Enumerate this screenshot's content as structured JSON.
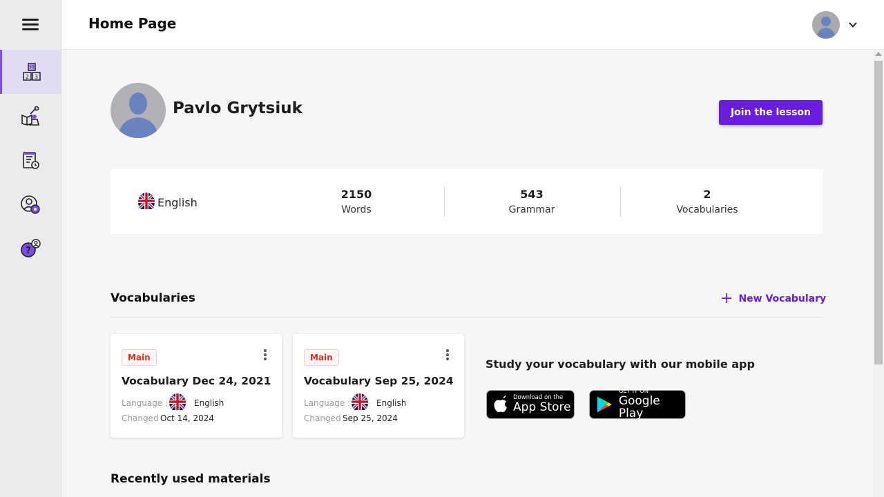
{
  "header": {
    "title": "Home Page"
  },
  "profile": {
    "name": "Pavlo Grytsiuk",
    "join_label": "Join the lesson"
  },
  "stats": {
    "language": "English",
    "items": [
      {
        "value": "2150",
        "label": "Words"
      },
      {
        "value": "543",
        "label": "Grammar"
      },
      {
        "value": "2",
        "label": "Vocabularies"
      }
    ]
  },
  "vocab_section": {
    "title": "Vocabularies",
    "new_label": "New Vocabulary",
    "cards": [
      {
        "badge": "Main",
        "title": "Vocabulary Dec 24, 2021",
        "language_label": "Language :",
        "language": "English",
        "changed_label": "Changed :",
        "changed": "Oct 14, 2024"
      },
      {
        "badge": "Main",
        "title": "Vocabulary Sep 25, 2024",
        "language_label": "Language :",
        "language": "English",
        "changed_label": "Changed :",
        "changed": "Sep 25, 2024"
      }
    ],
    "mobile_title": "Study your vocabulary with our mobile app",
    "app_store": {
      "small": "Download on the",
      "big": "App Store"
    },
    "google_play": {
      "small": "GET IT ON",
      "big": "Google Play"
    }
  },
  "recent": {
    "title": "Recently used materials"
  },
  "colors": {
    "accent": "#6a1de0",
    "badge_red": "#d93025",
    "active_nav": "#e2dcf3"
  },
  "icons": {
    "nav": [
      "blocks-icon",
      "learning-icon",
      "test-icon",
      "user-settings-icon",
      "help-icon"
    ],
    "header": [
      "avatar",
      "chevron-down-icon"
    ]
  }
}
